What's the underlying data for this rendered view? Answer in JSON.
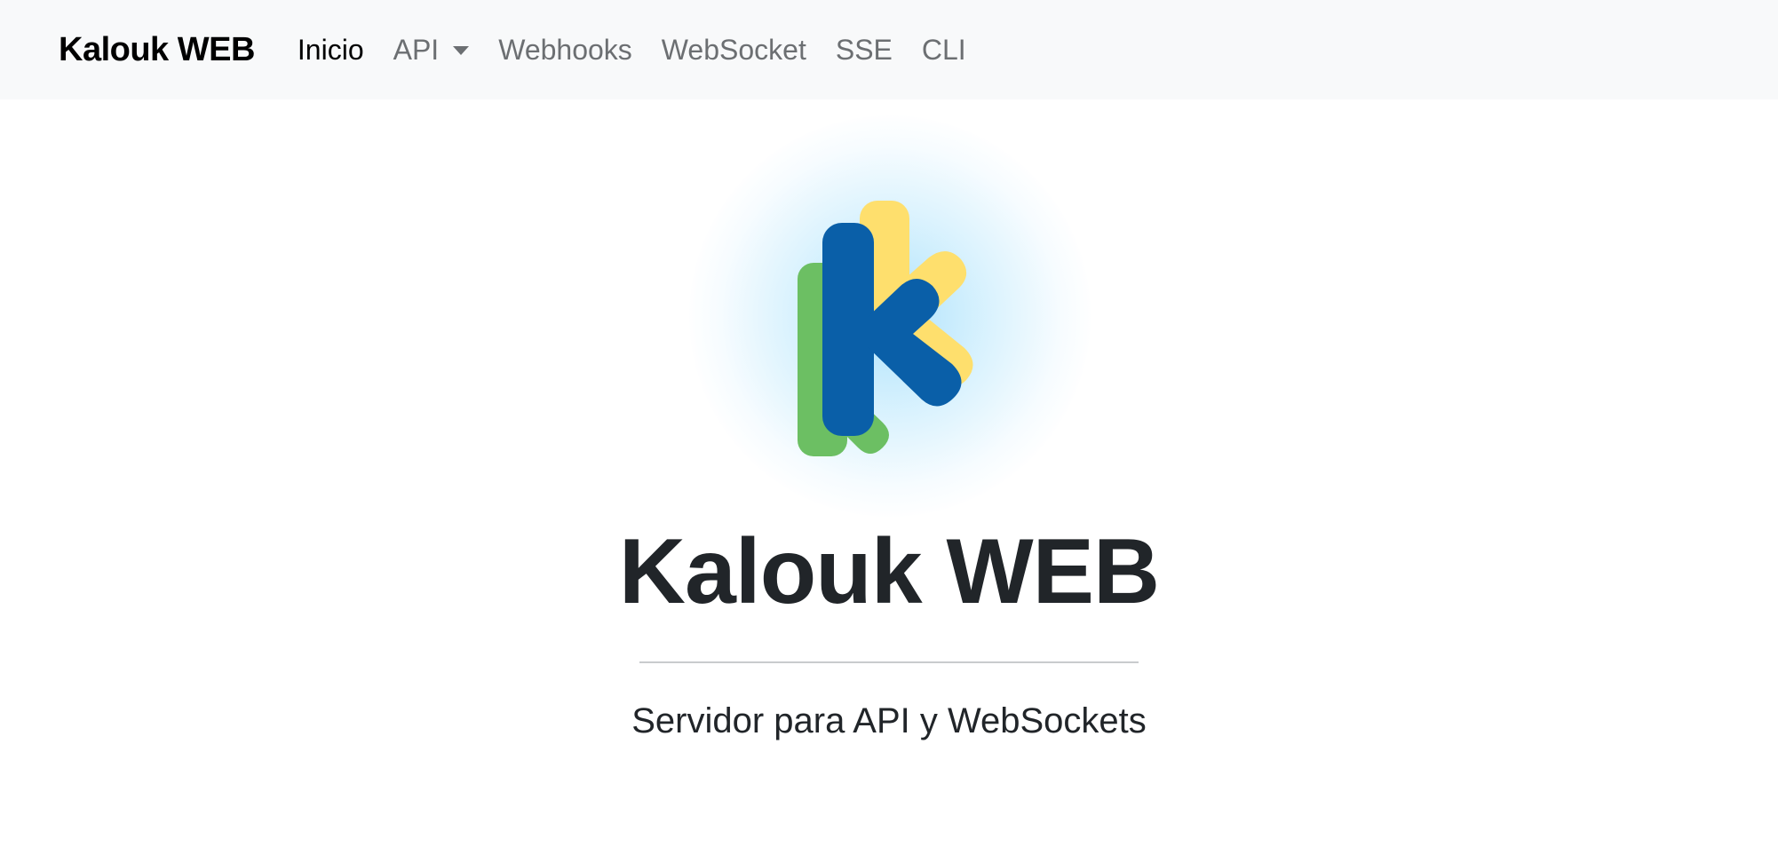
{
  "navbar": {
    "brand": "Kalouk WEB",
    "items": [
      {
        "label": "Inicio",
        "active": true
      },
      {
        "label": "API",
        "dropdown": true
      },
      {
        "label": "Webhooks"
      },
      {
        "label": "WebSocket"
      },
      {
        "label": "SSE"
      },
      {
        "label": "CLI"
      }
    ]
  },
  "hero": {
    "logo_icon": "kalouk-k-logo",
    "title": "Kalouk WEB",
    "subtitle": "Servidor para API y WebSockets"
  },
  "colors": {
    "navbar_bg": "#f8f9fa",
    "logo_blue": "#0a5fa8",
    "logo_green": "#6cbf63",
    "logo_yellow": "#fedf6d",
    "glow": "#aee2fb",
    "text": "#212529"
  }
}
